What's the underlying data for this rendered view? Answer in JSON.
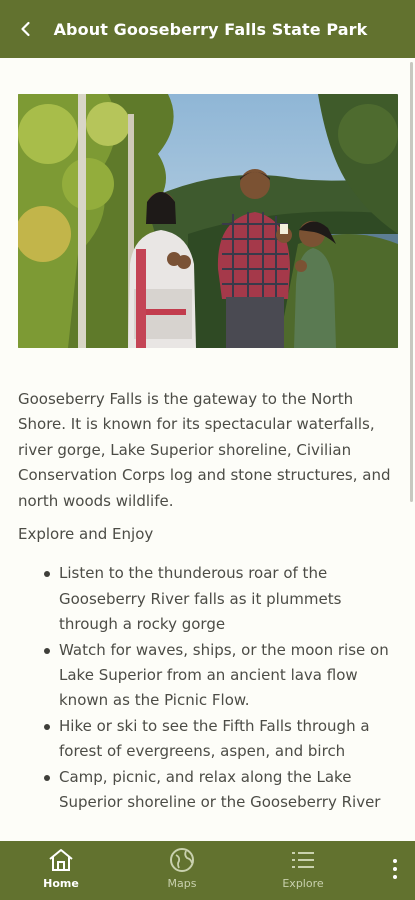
{
  "header": {
    "title": "About Gooseberry Falls State Park",
    "back_icon": "chevron-left-icon"
  },
  "hero": {
    "image_icon": "photo-family-overlook"
  },
  "content": {
    "intro": "Gooseberry Falls is the gateway to the North Shore. It is known for its spectacular waterfalls, river gorge, Lake Superior shoreline, Civilian Conservation Corps log and stone structures, and north woods wildlife.",
    "subhead": "Explore and Enjoy",
    "bullets": [
      "Listen to the thunderous roar of the Gooseberry River falls as it plummets through a rocky gorge",
      "Watch for waves, ships, or the moon rise on Lake Superior from an ancient lava flow known as the Picnic Flow.",
      "Hike or ski to see the Fifth Falls through a forest of evergreens, aspen, and birch",
      "Camp, picnic, and relax along the Lake Superior shoreline or the Gooseberry River"
    ]
  },
  "nav": {
    "items": [
      {
        "label": "Home",
        "icon": "home-icon",
        "active": true
      },
      {
        "label": "Maps",
        "icon": "globe-icon",
        "active": false
      },
      {
        "label": "Explore",
        "icon": "list-icon",
        "active": false
      }
    ],
    "more_icon": "more-vertical-icon"
  },
  "colors": {
    "brand": "#62722f",
    "background": "#fdfdf8",
    "text": "#4c4c46"
  }
}
